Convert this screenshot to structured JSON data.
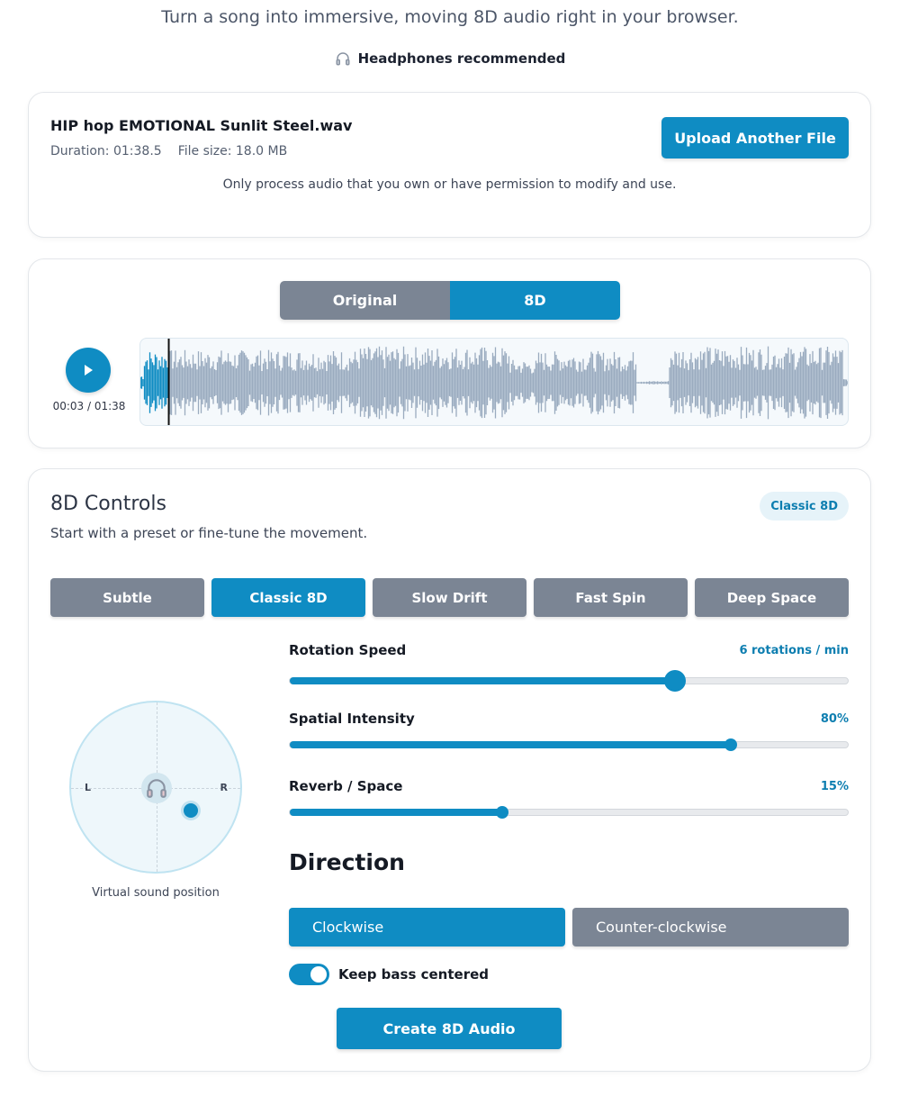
{
  "intro": "Turn a song into immersive, moving 8D audio right in your browser.",
  "headphones_note": {
    "icon": "headphones-icon",
    "text": "Headphones recommended"
  },
  "file": {
    "name": "HIP hop EMOTIONAL Sunlit Steel.wav",
    "duration": "Duration: 01:38.5",
    "size": "File size: 18.0 MB",
    "upload_label": "Upload Another File",
    "permission_note": "Only process audio that you own or have permission to modify and use."
  },
  "player": {
    "toggle": {
      "original": "Original",
      "eight_d": "8D",
      "selected": "8D"
    },
    "play_icon": "play-icon",
    "time": "00:03 / 01:38",
    "progress_fraction": 0.04
  },
  "controls": {
    "title": "8D Controls",
    "subtitle": "Start with a preset or fine-tune the movement.",
    "active_preset_badge": "Classic 8D",
    "presets": [
      {
        "label": "Subtle",
        "active": false
      },
      {
        "label": "Classic 8D",
        "active": true
      },
      {
        "label": "Slow Drift",
        "active": false
      },
      {
        "label": "Fast Spin",
        "active": false
      },
      {
        "label": "Deep Space",
        "active": false
      }
    ],
    "pad": {
      "left_label": "L",
      "right_label": "R",
      "center_icon": "headphones-icon",
      "caption": "Virtual sound position"
    },
    "sliders": {
      "rotation": {
        "label": "Rotation Speed",
        "value": "6 rotations / min",
        "fraction": 0.69
      },
      "intensity": {
        "label": "Spatial Intensity",
        "value": "80%",
        "fraction": 0.79
      },
      "reverb": {
        "label": "Reverb / Space",
        "value": "15%",
        "fraction": 0.38
      }
    },
    "direction": {
      "title": "Direction",
      "clockwise": "Clockwise",
      "counter_clockwise": "Counter-clockwise",
      "selected": "Clockwise"
    },
    "keep_bass": {
      "label": "Keep bass centered",
      "on": true
    },
    "create_label": "Create 8D Audio"
  },
  "colors": {
    "accent": "#0f8cc3",
    "inactive": "#7b8594",
    "waveform": "#9aabbf"
  }
}
